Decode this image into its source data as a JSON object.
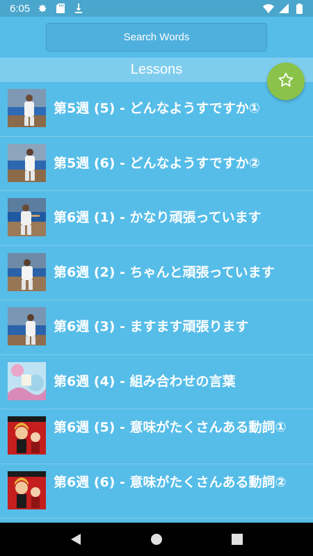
{
  "status_bar": {
    "time": "6:05",
    "left_icons": [
      "gear-icon",
      "sd-card-icon",
      "download-icon"
    ],
    "right_icons": [
      "wifi-icon",
      "cell-signal-icon",
      "battery-icon"
    ]
  },
  "search": {
    "placeholder": "Search Words"
  },
  "header": {
    "title": "Lessons"
  },
  "fab": {
    "icon": "star-outline-icon",
    "color": "#8bc34a"
  },
  "lessons": [
    {
      "title": "第5週 (5) - どんなようすですか①",
      "thumb": "baseball-player"
    },
    {
      "title": "第5週 (6) - どんなようすですか②",
      "thumb": "baseball-player"
    },
    {
      "title": "第6週 (1) - かなり頑張っています",
      "thumb": "baseball-player"
    },
    {
      "title": "第6週 (2) - ちゃんと頑張っています",
      "thumb": "baseball-player"
    },
    {
      "title": "第6週 (3) - ますます頑張ります",
      "thumb": "baseball-player"
    },
    {
      "title": "第6週 (4) - 組み合わせの言葉",
      "thumb": "anime-art"
    },
    {
      "title": "第6週 (5) - 意味がたくさんある動詞①",
      "thumb": "anime-red"
    },
    {
      "title": "第6週 (6) - 意味がたくさんある動詞②",
      "thumb": "anime-red"
    }
  ],
  "colors": {
    "background": "#56bde8",
    "header": "#7fcdee",
    "status_bar": "#4aa6cc",
    "text": "#ffffff"
  }
}
